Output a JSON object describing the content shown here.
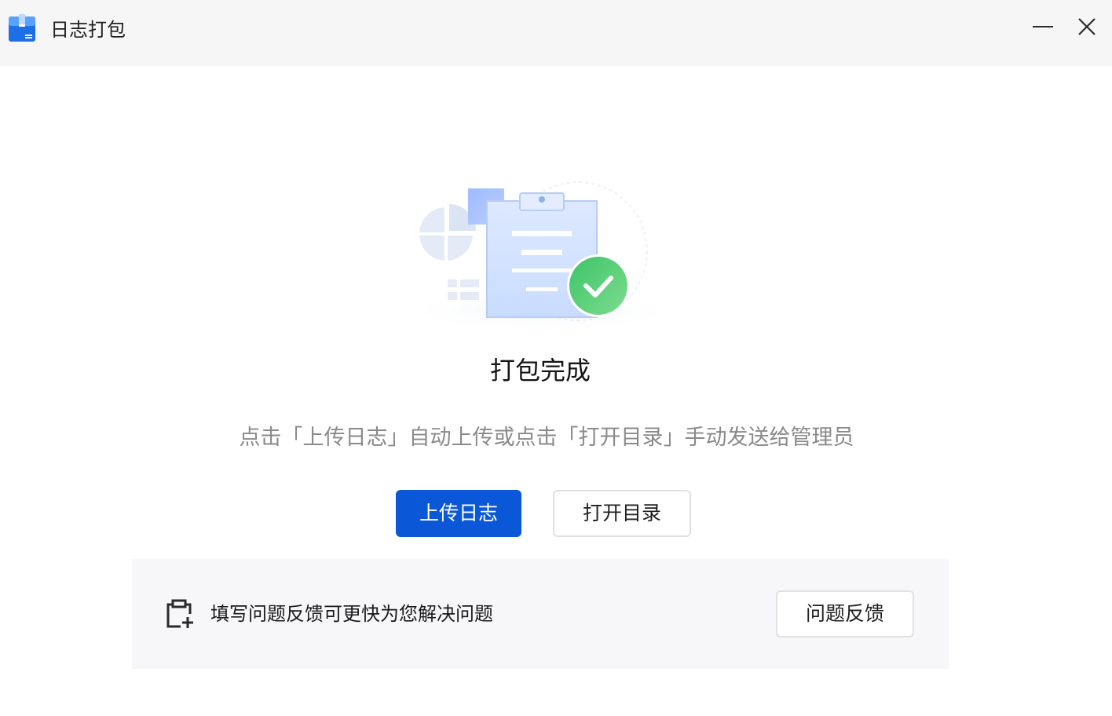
{
  "window": {
    "title": "日志打包",
    "app_icon": "log-package-icon",
    "controls": {
      "minimize_icon": "minimize-icon",
      "close_icon": "close-icon"
    }
  },
  "main": {
    "illustration": "clipboard-success-illustration",
    "status_title": "打包完成",
    "hint": "点击「上传日志」自动上传或点击「打开目录」手动发送给管理员",
    "upload_button": "上传日志",
    "open_dir_button": "打开目录"
  },
  "feedback": {
    "icon": "clipboard-add-icon",
    "text": "填写问题反馈可更快为您解决问题",
    "button": "问题反馈"
  },
  "colors": {
    "primary": "#0a58d8",
    "success": "#43c46a",
    "titlebar_bg": "#f6f6f7",
    "panel_bg": "#f7f7f9",
    "hint_text": "#8a8a8a"
  }
}
